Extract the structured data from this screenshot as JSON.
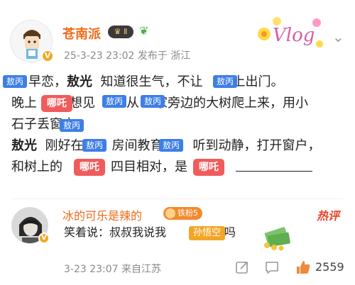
{
  "post": {
    "author": "苍南派",
    "level_badge": "Ⅱ",
    "meta": "25-3-23 23:02  发布于 浙江",
    "sticker_text": "Vlog",
    "lines": {
      "l1_a": "早恋，",
      "l1_name": "敖光",
      "l1_b": "知道很生气，不让",
      "l1_c": "晚上出门。",
      "l2_a": "晚上",
      "l2_b": "想见",
      "l2_c": "从",
      "l2_d": "家旁边的大树爬上来，用小",
      "l3_a": "石子丢",
      "l3_b": "窗户。",
      "l4_name": "敖光",
      "l4_a": "刚好在",
      "l4_b": "房间教育",
      "l4_c": "听到动静，打开窗户，",
      "l5_a": "和树上的",
      "l5_b": "四目相对，",
      "l5_c": "是"
    },
    "tags": {
      "aobing": "敖丙",
      "nezha": "哪吒"
    }
  },
  "comment": {
    "author": "冰的可乐是辣的",
    "fan_badge": "铁粉5",
    "hot_label": "热评",
    "text_a": "笑着说：叔叔我说我",
    "tag": "孙悟空",
    "text_b": "你信吗",
    "meta": "3-23 23:07  来自江苏",
    "likes": "2559"
  },
  "icons": [
    "vip-badge-icon",
    "sprout-icon",
    "more-icon",
    "share-icon",
    "comment-icon",
    "like-icon",
    "money-sticker-icon"
  ]
}
